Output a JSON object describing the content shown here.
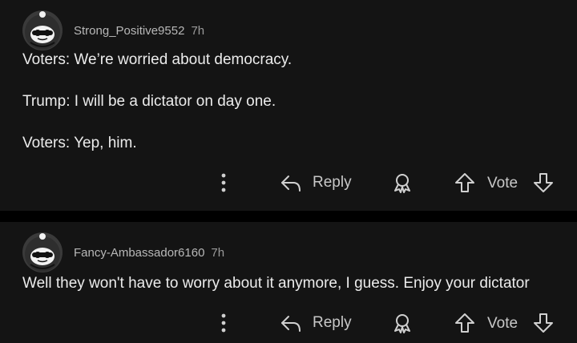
{
  "comments": [
    {
      "username": "Strong_Positive9552",
      "time": "7h",
      "lines": [
        "Voters: We’re worried about democracy.",
        "Trump: I will be a dictator on day one.",
        "Voters: Yep, him."
      ],
      "reply_label": "Reply",
      "vote_label": "Vote"
    },
    {
      "username": "Fancy-Ambassador6160",
      "time": "7h",
      "lines": [
        "Well they won't have to worry about it anymore, I guess. Enjoy your dictator"
      ],
      "reply_label": "Reply",
      "vote_label": "Vote"
    }
  ],
  "icons": {
    "more": "more-vertical-icon",
    "reply": "reply-arrow-icon",
    "award": "award-icon",
    "upvote": "upvote-arrow-icon",
    "downvote": "downvote-arrow-icon"
  },
  "colors": {
    "background": "#141414",
    "separator": "#000000",
    "text": "#ececec",
    "muted": "#b8b8b8"
  }
}
